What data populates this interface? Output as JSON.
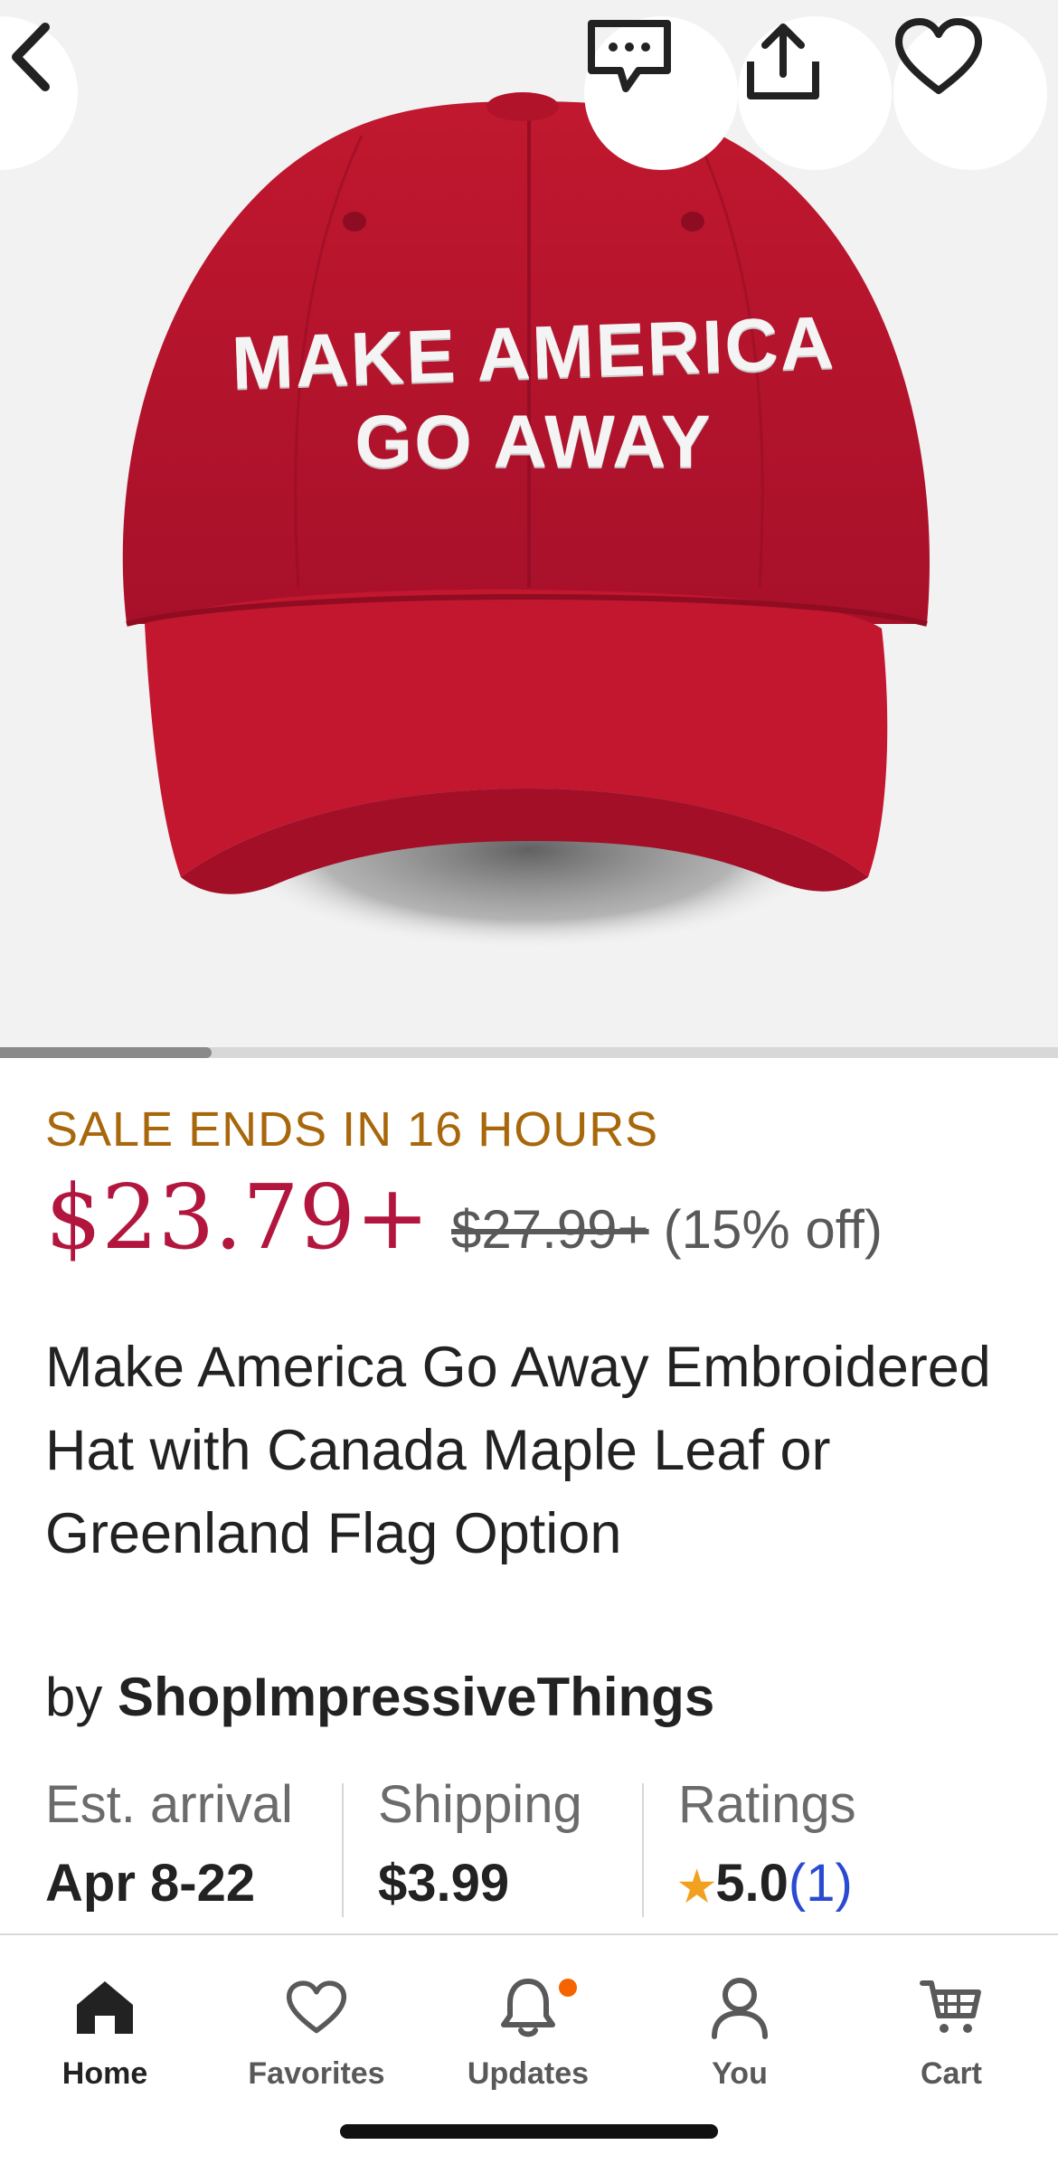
{
  "product_image": {
    "hat_text_line1": "MAKE AMERICA",
    "hat_text_line2": "GO AWAY",
    "hat_color": "#b3132b",
    "gallery_progress": 0.2
  },
  "top_actions": {
    "back_icon": "chevron-left-icon",
    "message_icon": "message-icon",
    "share_icon": "share-icon",
    "favorite_icon": "heart-icon"
  },
  "listing": {
    "sale_banner": "SALE ENDS IN 16 HOURS",
    "price": "$23.79+",
    "original_price": "$27.99+",
    "discount": "(15% off)",
    "title": "Make America Go Away Embroidered Hat with Canada Maple Leaf or Greenland Flag Option",
    "by_prefix": "by",
    "shop_name": "ShopImpressiveThings"
  },
  "info": {
    "arrival_label": "Est. arrival",
    "arrival_value": "Apr 8-22",
    "shipping_label": "Shipping",
    "shipping_value": "$3.99",
    "ratings_label": "Ratings",
    "rating_value": "5.0",
    "rating_count": "(1)"
  },
  "tabs": [
    {
      "label": "Home",
      "icon": "home-icon",
      "active": true
    },
    {
      "label": "Favorites",
      "icon": "heart-icon",
      "active": false
    },
    {
      "label": "Updates",
      "icon": "bell-icon",
      "active": false
    },
    {
      "label": "You",
      "icon": "person-icon",
      "active": false
    },
    {
      "label": "Cart",
      "icon": "cart-icon",
      "active": false
    }
  ],
  "colors": {
    "sale": "#a8670b",
    "price": "#b2163e",
    "link": "#2a4ad1",
    "star": "#f1a11f",
    "notification": "#f56400"
  }
}
